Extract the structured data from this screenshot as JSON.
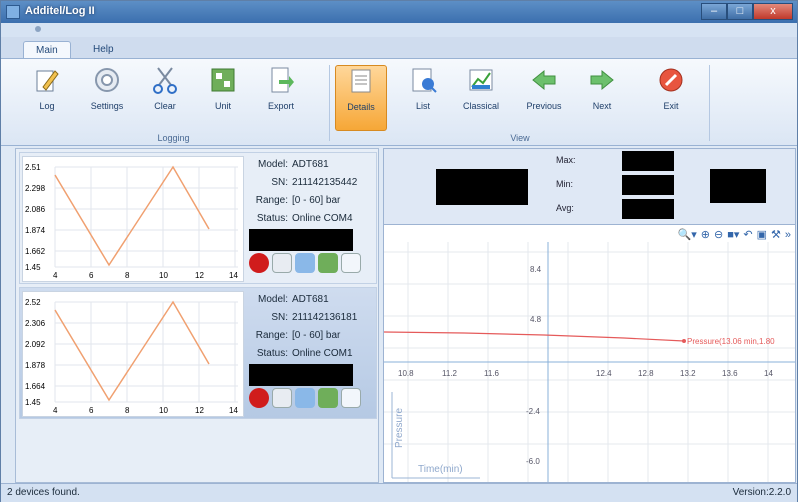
{
  "window": {
    "title": "Additel/Log II"
  },
  "tabs": [
    "Main",
    "Help"
  ],
  "ribbon": {
    "buttons": [
      {
        "label": "Log",
        "icon": "pencil-icon"
      },
      {
        "label": "Settings",
        "icon": "gear-icon"
      },
      {
        "label": "Clear",
        "icon": "scissors-icon"
      },
      {
        "label": "Unit",
        "icon": "unit-icon"
      },
      {
        "label": "Export",
        "icon": "export-icon"
      },
      {
        "label": "Details",
        "icon": "details-icon"
      },
      {
        "label": "List",
        "icon": "list-icon"
      },
      {
        "label": "Classical",
        "icon": "chart-icon"
      },
      {
        "label": "Previous",
        "icon": "arrow-left-icon"
      },
      {
        "label": "Next",
        "icon": "arrow-right-icon"
      },
      {
        "label": "Exit",
        "icon": "exit-icon"
      }
    ],
    "groups": [
      "Logging",
      "View"
    ]
  },
  "devices": [
    {
      "model_key": "Model:",
      "model": "ADT681",
      "sn_key": "SN:",
      "sn": "211142135442",
      "range_key": "Range:",
      "range": "[0 - 60] bar",
      "status_key": "Status:",
      "status": "Online  COM4",
      "yticks": [
        "2.51",
        "2.298",
        "2.086",
        "1.874",
        "1.662",
        "1.45"
      ],
      "xticks": [
        "4",
        "6",
        "8",
        "10",
        "12",
        "14"
      ]
    },
    {
      "model_key": "Model:",
      "model": "ADT681",
      "sn_key": "SN:",
      "sn": "211142136181",
      "range_key": "Range:",
      "range": "[0 - 60] bar",
      "status_key": "Status:",
      "status": "Online  COM1",
      "yticks": [
        "2.52",
        "2.306",
        "2.092",
        "1.878",
        "1.664",
        "1.45"
      ],
      "xticks": [
        "4",
        "6",
        "8",
        "10",
        "12",
        "14"
      ]
    }
  ],
  "stats": {
    "max": "Max:",
    "min": "Min:",
    "avg": "Avg:"
  },
  "main_chart": {
    "yticks": [
      "8.4",
      "4.8",
      "-2.4",
      "-6.0"
    ],
    "xticks": [
      "10.8",
      "11.2",
      "11.6",
      "12.4",
      "12.8",
      "13.2",
      "13.6",
      "14"
    ],
    "ylabel": "Pressure",
    "xlabel": "Time(min)",
    "annotation": "Pressure(13.06 min,1.80"
  },
  "status": {
    "left": "2 devices found.",
    "right": "Version:2.2.0"
  },
  "colors": {
    "accent": "#f6a737",
    "series": "#f0a070",
    "main_series": "#e55a5a"
  }
}
